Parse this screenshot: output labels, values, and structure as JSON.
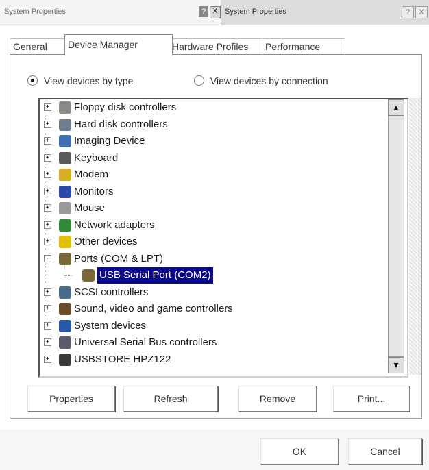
{
  "window": {
    "title": "System Properties",
    "ghost_title": "System Properties",
    "help_glyph": "?",
    "close_glyph": "X"
  },
  "tabs": [
    {
      "label": "General"
    },
    {
      "label": "Device Manager"
    },
    {
      "label": "Hardware Profiles"
    },
    {
      "label": "Performance"
    }
  ],
  "view_options": {
    "by_type": "View devices by type",
    "by_connection": "View devices by connection",
    "selected": "by_type"
  },
  "tree": [
    {
      "label": "Floppy disk controllers",
      "expander": "+",
      "icon": "floppy-controller-icon"
    },
    {
      "label": "Hard disk controllers",
      "expander": "+",
      "icon": "hard-disk-controller-icon"
    },
    {
      "label": "Imaging Device",
      "expander": "+",
      "icon": "imaging-device-icon"
    },
    {
      "label": "Keyboard",
      "expander": "+",
      "icon": "keyboard-icon"
    },
    {
      "label": "Modem",
      "expander": "+",
      "icon": "modem-icon"
    },
    {
      "label": "Monitors",
      "expander": "+",
      "icon": "monitor-icon"
    },
    {
      "label": "Mouse",
      "expander": "+",
      "icon": "mouse-icon"
    },
    {
      "label": "Network adapters",
      "expander": "+",
      "icon": "network-adapter-icon"
    },
    {
      "label": "Other devices",
      "expander": "+",
      "icon": "question-mark-icon"
    },
    {
      "label": "Ports (COM & LPT)",
      "expander": "-",
      "icon": "port-icon"
    },
    {
      "label": "USB Serial Port (COM2)",
      "child": true,
      "selected": true,
      "icon": "port-icon"
    },
    {
      "label": "SCSI controllers",
      "expander": "+",
      "icon": "scsi-controller-icon"
    },
    {
      "label": "Sound, video and game controllers",
      "expander": "+",
      "icon": "sound-icon"
    },
    {
      "label": "System devices",
      "expander": "+",
      "icon": "system-device-icon"
    },
    {
      "label": "Universal Serial Bus controllers",
      "expander": "+",
      "icon": "usb-controller-icon"
    },
    {
      "label": "USBSTORE HPZ122",
      "expander": "+",
      "icon": "usb-store-icon"
    }
  ],
  "scrollbar": {
    "up": "▲",
    "down": "▼"
  },
  "buttons": {
    "properties": "Properties",
    "refresh": "Refresh",
    "remove": "Remove",
    "print": "Print...",
    "ok": "OK",
    "cancel": "Cancel"
  },
  "colors": {
    "selection": "#0a0a8a",
    "tree_border": "#555555"
  }
}
